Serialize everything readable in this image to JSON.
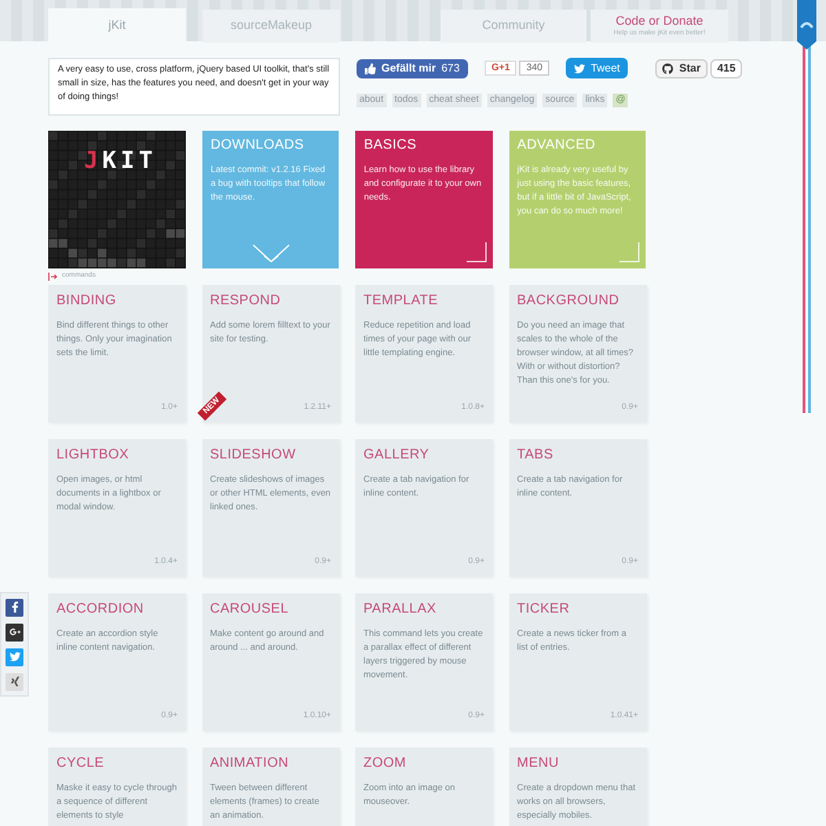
{
  "tabs": [
    {
      "label": "jKit",
      "selected": true,
      "kind": "plain"
    },
    {
      "label": "sourceMakeup",
      "selected": false,
      "kind": "plain"
    },
    {
      "label": "Community",
      "selected": false,
      "kind": "plain"
    },
    {
      "label": "Code or Donate",
      "sublabel": "Help us make jKit even better!",
      "selected": false,
      "kind": "cta"
    }
  ],
  "intro": "A very easy to use, cross platform, jQuery based UI toolkit, that's still small in size, has the features you need, and doesn't get in your way of doing things!",
  "social_buttons": [
    {
      "kind": "facebook",
      "label": "Gefällt mir",
      "count": "673"
    },
    {
      "kind": "gplus",
      "label": "G+1",
      "count": "340"
    },
    {
      "kind": "twitter",
      "label": "Tweet"
    },
    {
      "kind": "github",
      "label": "Star",
      "count": "415"
    }
  ],
  "links": [
    {
      "label": "about",
      "kind": "text"
    },
    {
      "label": "todos",
      "kind": "text"
    },
    {
      "label": "cheat sheet",
      "kind": "text"
    },
    {
      "label": "changelog",
      "kind": "text"
    },
    {
      "label": "source",
      "kind": "text"
    },
    {
      "label": "links",
      "kind": "text"
    },
    {
      "label": "@",
      "kind": "contact"
    }
  ],
  "logo": {
    "accent": "J",
    "rest": "KIT",
    "caption": "commands"
  },
  "feature_tiles": [
    {
      "title": "DOWNLOADS",
      "text": "Latest commit: v1.2.16 Fixed a bug with tooltips that follow the mouse.",
      "color": "#62b8e0",
      "kind": "download"
    },
    {
      "title": "BASICS",
      "text": "Learn how to use the library and configurate it to your own needs.",
      "color": "#c9255a",
      "kind": "corner"
    },
    {
      "title": "ADVANCED",
      "text": "jKit is already very useful by just using the basic features, but if a little bit of JavaScript, you can do so much more!",
      "color": "#b4d06e",
      "kind": "corner"
    }
  ],
  "commands": [
    {
      "title": "BINDING",
      "text": "Bind different things to other things. Only your imagination sets the limit.",
      "version": "1.0+"
    },
    {
      "title": "RESPOND",
      "text": "Add some lorem filltext to your site for testing.",
      "version": "1.2.11+",
      "badge": "NEW"
    },
    {
      "title": "TEMPLATE",
      "text": "Reduce repetition and load times of your page with our little templating engine.",
      "version": "1.0.8+"
    },
    {
      "title": "BACKGROUND",
      "text": "Do you need an image that scales to the whole of the browser window, at all times? With or without distortion? Than this one's for you.",
      "version": "0.9+"
    },
    {
      "title": "LIGHTBOX",
      "text": "Open images, or html documents in a lightbox or modal window.",
      "version": "1.0.4+"
    },
    {
      "title": "SLIDESHOW",
      "text": "Create slideshows of images or other HTML elements, even linked ones.",
      "version": "0.9+"
    },
    {
      "title": "GALLERY",
      "text": "Create a tab navigation for inline content.",
      "version": "0.9+"
    },
    {
      "title": "TABS",
      "text": "Create a tab navigation for inline content.",
      "version": "0.9+"
    },
    {
      "title": "ACCORDION",
      "text": "Create an accordion style inline content navigation.",
      "version": "0.9+"
    },
    {
      "title": "CAROUSEL",
      "text": "Make content go around and around ... and around.",
      "version": "1.0.10+"
    },
    {
      "title": "PARALLAX",
      "text": "This command lets you create a parallax effect of different layers triggered by mouse movement.",
      "version": "0.9+"
    },
    {
      "title": "TICKER",
      "text": "Create a news ticker from a list of entries.",
      "version": "1.0.41+"
    },
    {
      "title": "CYCLE",
      "text": "Maske it easy to cycle through a sequence of different elements to style"
    },
    {
      "title": "ANIMATION",
      "text": "Tween between different elements (frames) to create an animation."
    },
    {
      "title": "ZOOM",
      "text": "Zoom into an image on mouseover."
    },
    {
      "title": "MENU",
      "text": "Create a dropdown menu that works on all browsers, especially mobiles."
    }
  ],
  "share_sidebar": [
    {
      "kind": "facebook"
    },
    {
      "kind": "gplus"
    },
    {
      "kind": "twitter"
    },
    {
      "kind": "other"
    }
  ]
}
